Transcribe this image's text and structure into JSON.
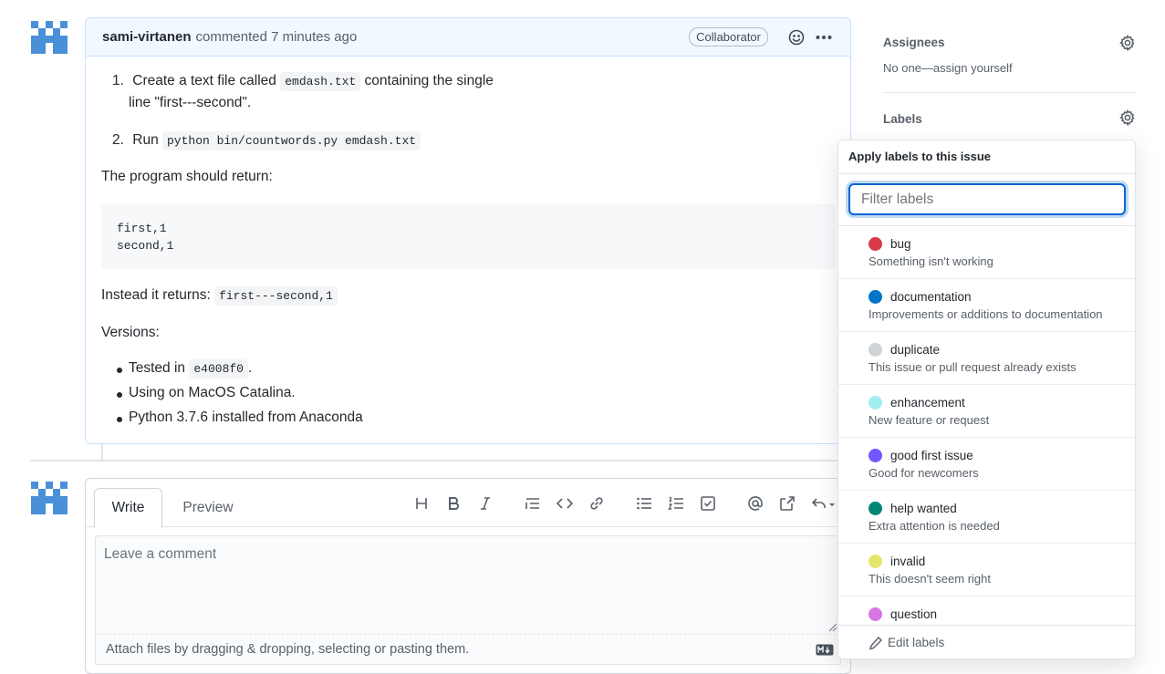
{
  "comment": {
    "author": "sami-virtanen",
    "action": "commented 7 minutes ago",
    "badge": "Collaborator",
    "steps": [
      {
        "number": "1.",
        "pre": "Create a text file called ",
        "code": "emdash.txt",
        "post": " containing the single",
        "line2": "line \"first---second\"."
      },
      {
        "number": "2.",
        "pre": "Run ",
        "code": "python bin/countwords.py emdash.txt"
      }
    ],
    "should_return": "The program should return:",
    "code_block": [
      "first,1",
      "second,1"
    ],
    "instead_prefix": "Instead it returns: ",
    "instead_code": "first---second,1",
    "versions_label": "Versions:",
    "versions": [
      {
        "pre": "Tested in ",
        "code": "e4008f0",
        "post": "."
      },
      {
        "pre": "Using on MacOS Catalina."
      },
      {
        "pre": "Python 3.7.6 installed from Anaconda"
      }
    ]
  },
  "editor": {
    "tab_write": "Write",
    "tab_preview": "Preview",
    "toolbar_icons": [
      "heading-icon",
      "bold-icon",
      "italic-icon",
      "quote-icon",
      "code-icon",
      "link-icon",
      "unordered-list-icon",
      "ordered-list-icon",
      "task-list-icon",
      "mention-icon",
      "cross-reference-icon",
      "reply-icon"
    ],
    "placeholder": "Leave a comment",
    "attach_text": "Attach files by dragging & dropping, selecting or pasting them."
  },
  "sidebar": {
    "assignees_heading": "Assignees",
    "assignees_value": "No one—assign yourself",
    "labels_heading": "Labels"
  },
  "label_popover": {
    "title": "Apply labels to this issue",
    "filter_placeholder": "Filter labels",
    "labels": [
      {
        "name": "bug",
        "description": "Something isn't working",
        "color": "#d73a4a"
      },
      {
        "name": "documentation",
        "description": "Improvements or additions to documentation",
        "color": "#0075ca"
      },
      {
        "name": "duplicate",
        "description": "This issue or pull request already exists",
        "color": "#cfd3d7"
      },
      {
        "name": "enhancement",
        "description": "New feature or request",
        "color": "#a2eeef"
      },
      {
        "name": "good first issue",
        "description": "Good for newcomers",
        "color": "#7057ff"
      },
      {
        "name": "help wanted",
        "description": "Extra attention is needed",
        "color": "#008672"
      },
      {
        "name": "invalid",
        "description": "This doesn't seem right",
        "color": "#e4e669"
      },
      {
        "name": "question",
        "description": "",
        "color": "#d876e3"
      }
    ],
    "edit_labels": "Edit labels"
  }
}
